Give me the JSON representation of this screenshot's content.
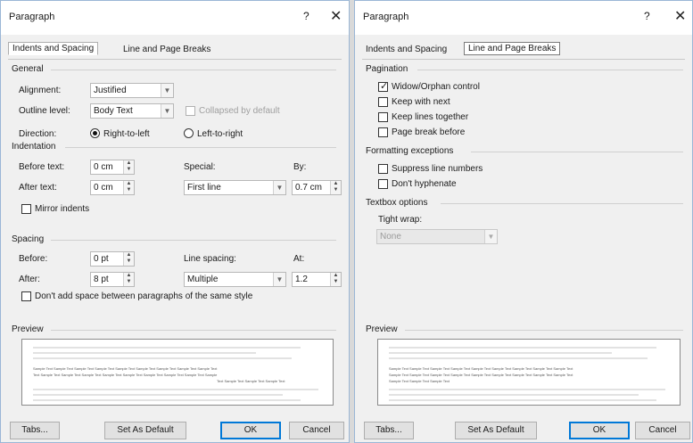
{
  "left": {
    "title": "Paragraph",
    "help": "?",
    "close": "✕",
    "tabs": [
      "Indents and Spacing",
      "Line and Page Breaks"
    ],
    "general": {
      "heading": "General",
      "alignment_label": "Alignment:",
      "alignment_value": "Justified",
      "outline_label": "Outline level:",
      "outline_value": "Body Text",
      "collapsed_label": "Collapsed by default",
      "direction_label": "Direction:",
      "rtl_label": "Right-to-left",
      "ltr_label": "Left-to-right"
    },
    "indentation": {
      "heading": "Indentation",
      "before_label": "Before text:",
      "before_value": "0 cm",
      "after_label": "After text:",
      "after_value": "0 cm",
      "special_label": "Special:",
      "special_value": "First line",
      "by_label": "By:",
      "by_value": "0.7 cm",
      "mirror_label": "Mirror indents"
    },
    "spacing": {
      "heading": "Spacing",
      "before_label": "Before:",
      "before_value": "0 pt",
      "after_label": "After:",
      "after_value": "8 pt",
      "line_label": "Line spacing:",
      "line_value": "Multiple",
      "at_label": "At:",
      "at_value": "1.2",
      "dont_add_label": "Don't add space between paragraphs of the same style"
    },
    "preview": {
      "heading": "Preview",
      "line1": "Sample Text Sample Text Sample Text Sample Text Sample Text Sample Text Sample Text Sample Text Sample Text",
      "line2": "Text Sample Text Sample Text Sample Text Sample Text Sample Text Sample Text Sample Text Sample Text Sample",
      "line3": "Text Sample Text Sample Text Sample Text"
    },
    "buttons": {
      "tabs": "Tabs...",
      "default": "Set As Default",
      "ok": "OK",
      "cancel": "Cancel"
    }
  },
  "right": {
    "title": "Paragraph",
    "help": "?",
    "close": "✕",
    "tabs": [
      "Indents and Spacing",
      "Line and Page Breaks"
    ],
    "pagination": {
      "heading": "Pagination",
      "widow": "Widow/Orphan control",
      "keep_next": "Keep with next",
      "keep_lines": "Keep lines together",
      "page_break": "Page break before"
    },
    "formatting": {
      "heading": "Formatting exceptions",
      "suppress": "Suppress line numbers",
      "dont_hyphenate": "Don't hyphenate"
    },
    "textbox": {
      "heading": "Textbox options",
      "tight_label": "Tight wrap:",
      "tight_value": "None"
    },
    "preview": {
      "heading": "Preview",
      "line1": "Sample Text Sample Text Sample Text Sample Text Sample Text Sample Text Sample Text Sample Text Sample Text",
      "line2": "Sample Text Sample Text Sample Text Sample Text Sample Text Sample Text Sample Text Sample Text Sample Text",
      "line3": "Sample Text Sample Text Sample Text"
    },
    "buttons": {
      "tabs": "Tabs...",
      "default": "Set As Default",
      "ok": "OK",
      "cancel": "Cancel"
    }
  }
}
